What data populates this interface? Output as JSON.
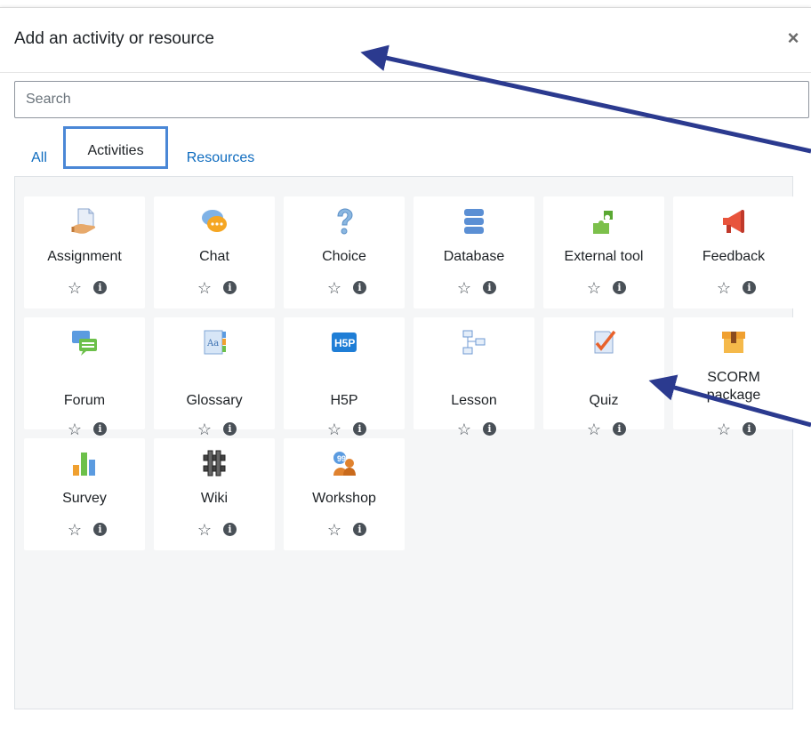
{
  "modal": {
    "title": "Add an activity or resource",
    "close_symbol": "×"
  },
  "search": {
    "placeholder": "Search"
  },
  "tabs": [
    {
      "label": "All"
    },
    {
      "label": "Activities"
    },
    {
      "label": "Resources"
    }
  ],
  "tiles": [
    {
      "label": "Assignment",
      "icon": "assignment-icon"
    },
    {
      "label": "Chat",
      "icon": "chat-icon"
    },
    {
      "label": "Choice",
      "icon": "choice-icon"
    },
    {
      "label": "Database",
      "icon": "database-icon"
    },
    {
      "label": "External tool",
      "icon": "external-tool-icon"
    },
    {
      "label": "Feedback",
      "icon": "feedback-icon"
    },
    {
      "label": "Forum",
      "icon": "forum-icon"
    },
    {
      "label": "Glossary",
      "icon": "glossary-icon"
    },
    {
      "label": "H5P",
      "icon": "h5p-icon"
    },
    {
      "label": "Lesson",
      "icon": "lesson-icon"
    },
    {
      "label": "Quiz",
      "icon": "quiz-icon"
    },
    {
      "label": "SCORM package",
      "icon": "scorm-icon"
    },
    {
      "label": "Survey",
      "icon": "survey-icon"
    },
    {
      "label": "Wiki",
      "icon": "wiki-icon"
    },
    {
      "label": "Workshop",
      "icon": "workshop-icon"
    }
  ],
  "tile_actions": {
    "star": "☆",
    "info": "i"
  },
  "colors": {
    "link": "#0f6cbf",
    "active_tab_border": "#4a87d6",
    "annotation_arrow": "#2b3a8f"
  }
}
